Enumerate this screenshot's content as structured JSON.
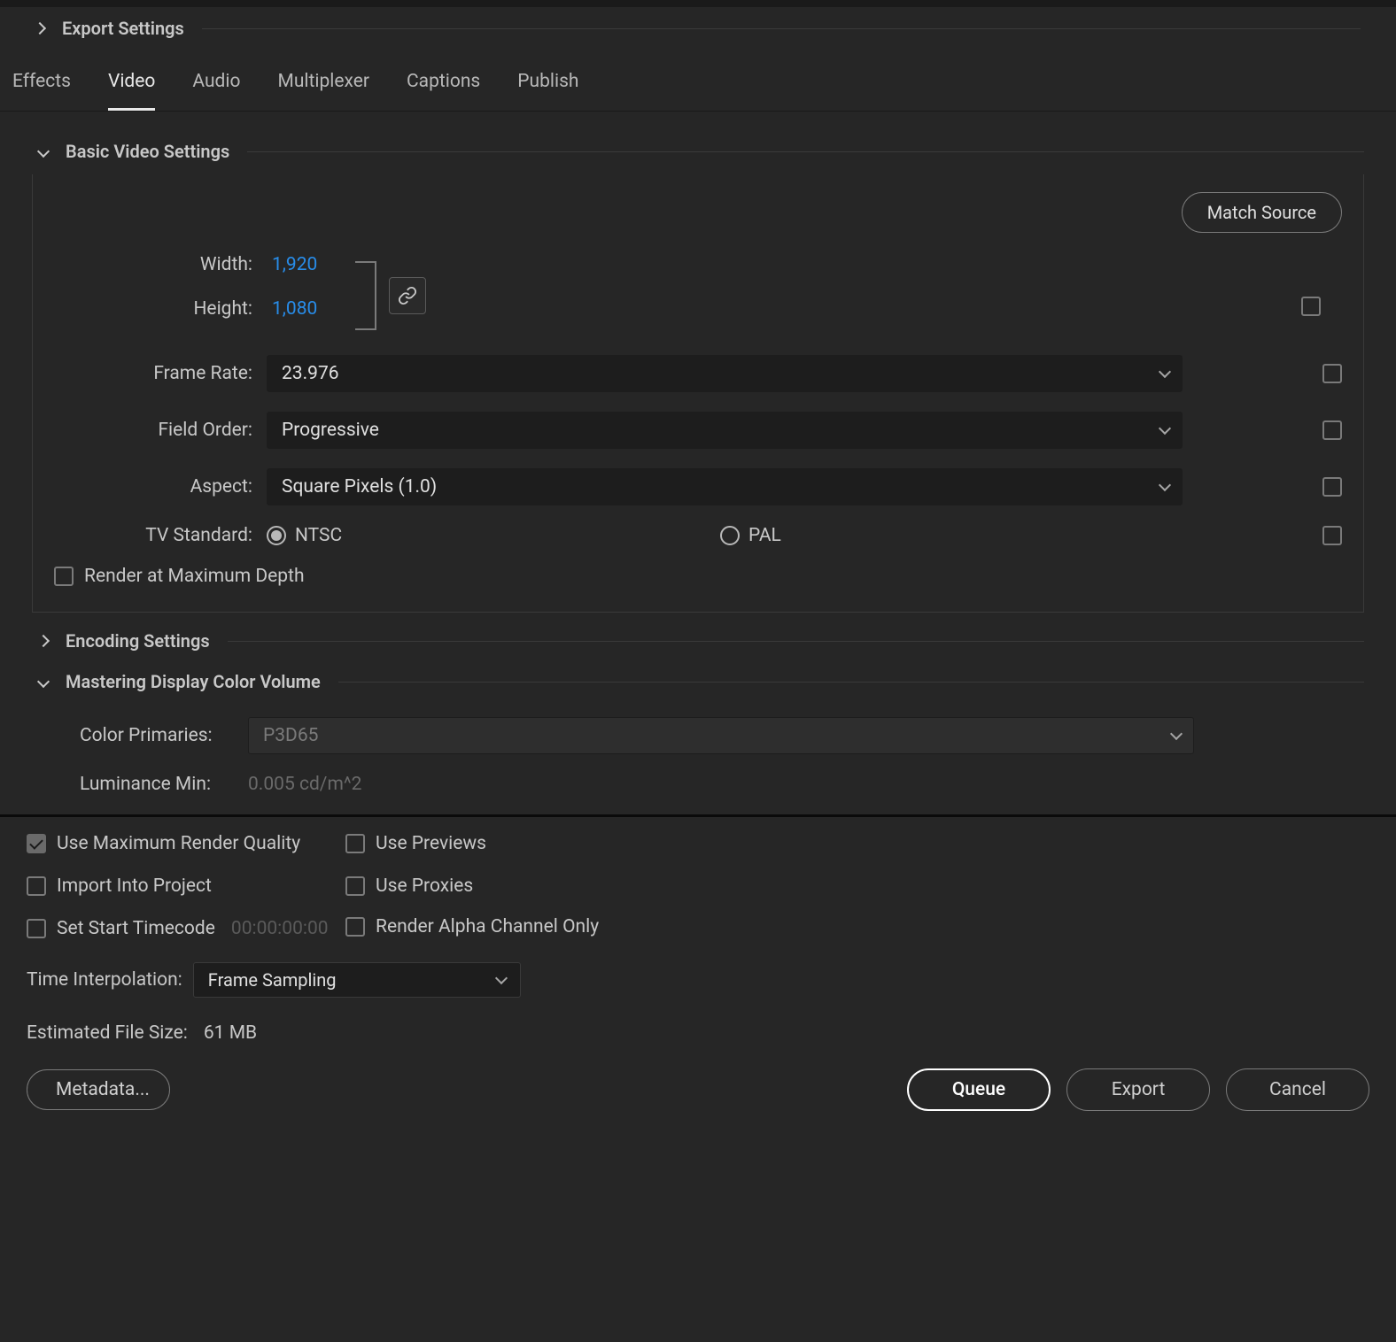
{
  "header": {
    "export_settings": "Export Settings"
  },
  "tabs": {
    "effects": "Effects",
    "video": "Video",
    "audio": "Audio",
    "multiplexer": "Multiplexer",
    "captions": "Captions",
    "publish": "Publish"
  },
  "basic_video": {
    "title": "Basic Video Settings",
    "match_source": "Match Source",
    "width_label": "Width:",
    "width_value": "1,920",
    "height_label": "Height:",
    "height_value": "1,080",
    "frame_rate_label": "Frame Rate:",
    "frame_rate_value": "23.976",
    "field_order_label": "Field Order:",
    "field_order_value": "Progressive",
    "aspect_label": "Aspect:",
    "aspect_value": "Square Pixels (1.0)",
    "tv_standard_label": "TV Standard:",
    "tv_ntsc": "NTSC",
    "tv_pal": "PAL",
    "render_max_depth": "Render at Maximum Depth"
  },
  "encoding": {
    "title": "Encoding Settings"
  },
  "mastering": {
    "title": "Mastering Display Color Volume",
    "color_primaries_label": "Color Primaries:",
    "color_primaries_value": "P3D65",
    "lum_min_label": "Luminance Min:",
    "lum_min_value": "0.005 cd/m^2"
  },
  "bottom": {
    "use_max_render": "Use Maximum Render Quality",
    "use_previews": "Use Previews",
    "import_into_project": "Import Into Project",
    "use_proxies": "Use Proxies",
    "set_start_timecode": "Set Start Timecode",
    "timecode_placeholder": "00:00:00:00",
    "render_alpha": "Render Alpha Channel Only",
    "time_interp_label": "Time Interpolation:",
    "time_interp_value": "Frame Sampling",
    "est_file_size_label": "Estimated File Size:",
    "est_file_size_value": "61 MB",
    "metadata_btn": "Metadata...",
    "queue_btn": "Queue",
    "export_btn": "Export",
    "cancel_btn": "Cancel"
  }
}
